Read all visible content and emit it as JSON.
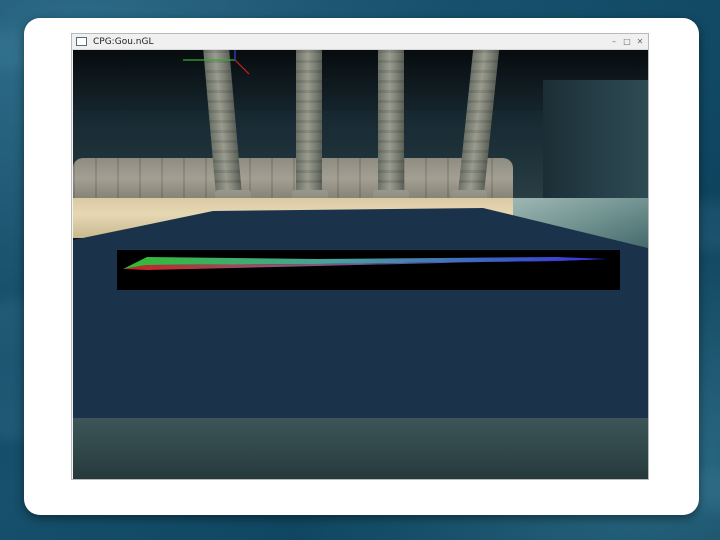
{
  "window": {
    "title": "CPG:Gou.nGL",
    "controls": {
      "minimize": "–",
      "maximize": "□",
      "close": "✕"
    }
  },
  "viewport": {
    "scene": "3D room with stone pillars, sand floor and a blue water plane",
    "colors": {
      "water": "#1b334a",
      "sand": "#e7d8b4",
      "stone": "#9a9b8e",
      "gradient_start": "#cc2222",
      "gradient_mid": "#33bb33",
      "gradient_end": "#3333dd"
    },
    "axis_gizmo_icons": [
      "x-axis-line-icon",
      "y-axis-line-icon",
      "z-axis-line-icon"
    ]
  }
}
